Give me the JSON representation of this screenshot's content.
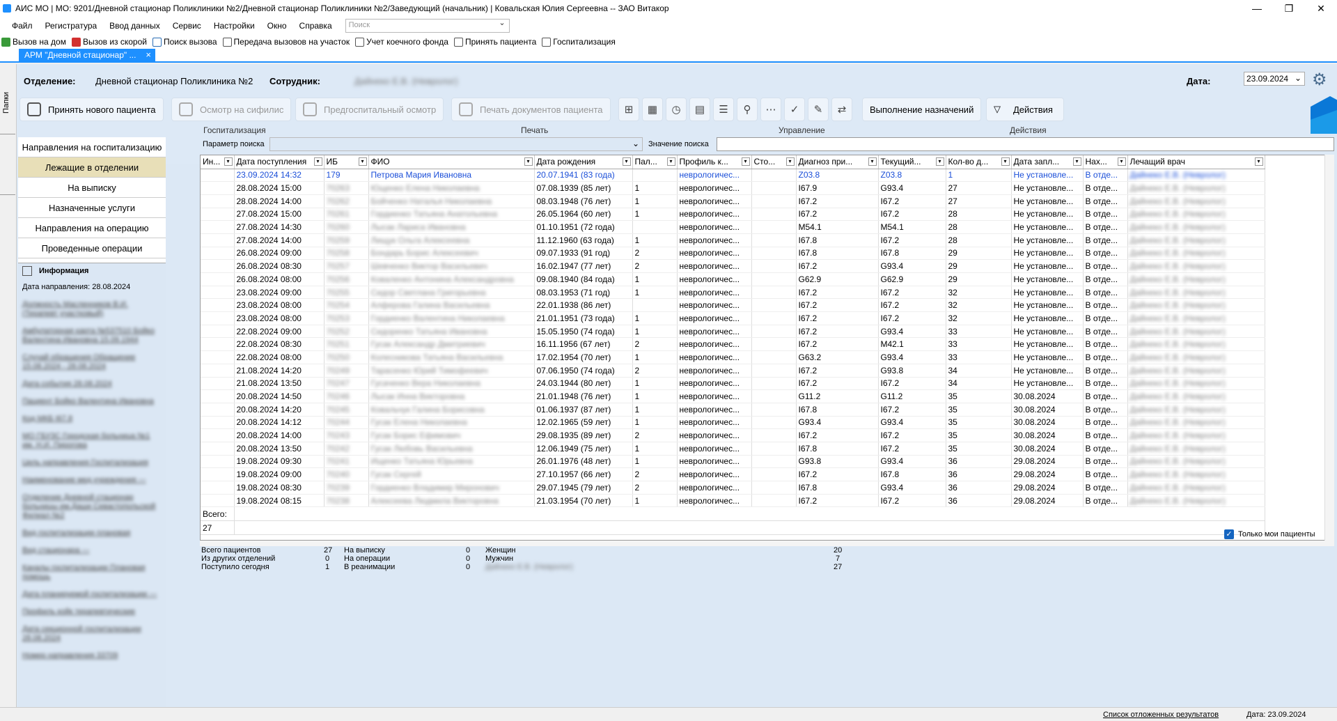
{
  "window": {
    "title": "АИС МО | МО: 9201/Дневной стационар Поликлиники №2/Дневной стационар Поликлиники №2/Заведующий (начальник) | Ковальская Юлия Сергеевна -- ЗАО Витакор"
  },
  "menu": [
    "Файл",
    "Регистратура",
    "Ввод данных",
    "Сервис",
    "Настройки",
    "Окно",
    "Справка"
  ],
  "menu_search_placeholder": "Поиск",
  "quick": [
    "Вызов на дом",
    "Вызов из скорой",
    "Поиск вызова",
    "Передача вызовов на участок",
    "Учет коечного фонда",
    "Принять пациента",
    "Госпитализация"
  ],
  "tab": {
    "label": "АРМ \"Дневной стационар\" ...",
    "close": "×"
  },
  "left_strip_label": "Папки",
  "header": {
    "dept_label": "Отделение:",
    "dept_value": "Дневной стационар Поликлиника №2",
    "emp_label": "Сотрудник:",
    "emp_value": "Дайнеко Е.В. (Невролог)",
    "date_label": "Дата:",
    "date_value": "23.09.2024"
  },
  "toolbar": {
    "new_patient": "Принять нового пациента",
    "syphilis": "Осмотр на сифилис",
    "prehosp": "Предгоспитальный осмотр",
    "print_docs": "Печать документов пациента",
    "appointments": "Выполнение назначений",
    "actions": "Действия"
  },
  "groups": {
    "hosp": "Госпитализация",
    "print": "Печать",
    "manage": "Управление",
    "actions": "Действия"
  },
  "nav": [
    "Направления на госпитализацию",
    "Лежащие в отделении",
    "На выписку",
    "Назначенные услуги",
    "Направления на операцию",
    "Проведенные операции"
  ],
  "info": {
    "title": "Информация",
    "date": "Дата направления: 28.08.2024",
    "lines": [
      "Должность Масленников В.И. (Терапевт участковый)",
      "Амбулаторная карта №537510 Бойко Валентина Ивановна 15.09.1944",
      "Случай обращения Обращение 15.08.2024 - 28.08.2024",
      "Дата события 28.08.2024",
      "Пациент Бойко Валентина Ивановна",
      "Код МКБ I67.8",
      "МО ГБУЗС Городская больница №1 им. Н.И. Пирогова",
      "Цель направления Госпитализация",
      "Наименование мед.учреждения ---",
      "Отделение Дневной стационар больницы им.Даши Севастопольской Филиал №2",
      "Вид госпитализации плановая",
      "Вид стационара ---",
      "Каналы госпитализации Плановая помощь",
      "Дата планируемой госпитализации ---",
      "Профиль койк терапевтические",
      "Дата секционной госпитализации 28.08.2024",
      "Номер направления 33709"
    ]
  },
  "search": {
    "param_label": "Параметр поиска",
    "value_label": "Значение поиска"
  },
  "columns": [
    "Ин...",
    "Дата поступления",
    "ИБ",
    "ФИО",
    "Дата рождения",
    "Пал...",
    "Профиль к...",
    "Сто...",
    "Диагноз при...",
    "Текущий...",
    "Кол-во д...",
    "Дата запл...",
    "Нах...",
    "Лечащий врач"
  ],
  "rows": [
    [
      "",
      "23.09.2024 14:32",
      "179",
      "Петрова Мария Ивановна",
      "20.07.1941 (83 года)",
      "",
      "неврологичес...",
      "",
      "Z03.8",
      "Z03.8",
      "1",
      "Не установле...",
      "В отде...",
      "Дайнеко Е.В. (Невролог)"
    ],
    [
      "",
      "28.08.2024 15:00",
      "70263",
      "Ющенко Елена Николаевна",
      "07.08.1939 (85 лет)",
      "1",
      "неврологичес...",
      "",
      "I67.9",
      "G93.4",
      "27",
      "Не установле...",
      "В отде...",
      "Дайнеко Е.В. (Невролог)"
    ],
    [
      "",
      "28.08.2024 14:00",
      "70262",
      "Бойченко Наталья Николаевна",
      "08.03.1948 (76 лет)",
      "1",
      "неврологичес...",
      "",
      "I67.2",
      "I67.2",
      "27",
      "Не установле...",
      "В отде...",
      "Дайнеко Е.В. (Невролог)"
    ],
    [
      "",
      "27.08.2024 15:00",
      "70261",
      "Гордиенко Татьяна Анатольевна",
      "26.05.1964 (60 лет)",
      "1",
      "неврологичес...",
      "",
      "I67.2",
      "I67.2",
      "28",
      "Не установле...",
      "В отде...",
      "Дайнеко Е.В. (Невролог)"
    ],
    [
      "",
      "27.08.2024 14:30",
      "70260",
      "Лысак Лариса Ивановна",
      "01.10.1951 (72 года)",
      "",
      "неврологичес...",
      "",
      "M54.1",
      "M54.1",
      "28",
      "Не установле...",
      "В отде...",
      "Дайнеко Е.В. (Невролог)"
    ],
    [
      "",
      "27.08.2024 14:00",
      "70259",
      "Лищук Ольга Алексеевна",
      "11.12.1960 (63 года)",
      "1",
      "неврологичес...",
      "",
      "I67.8",
      "I67.2",
      "28",
      "Не установле...",
      "В отде...",
      "Дайнеко Е.В. (Невролог)"
    ],
    [
      "",
      "26.08.2024 09:00",
      "70258",
      "Бондарь Борис Алексеевич",
      "09.07.1933 (91 год)",
      "2",
      "неврологичес...",
      "",
      "I67.8",
      "I67.8",
      "29",
      "Не установле...",
      "В отде...",
      "Дайнеко Е.В. (Невролог)"
    ],
    [
      "",
      "26.08.2024 08:30",
      "70257",
      "Шевченко Виктор Васильевич",
      "16.02.1947 (77 лет)",
      "2",
      "неврологичес...",
      "",
      "I67.2",
      "G93.4",
      "29",
      "Не установле...",
      "В отде...",
      "Дайнеко Е.В. (Невролог)"
    ],
    [
      "",
      "26.08.2024 08:00",
      "70256",
      "Коваленко Антонина Александровна",
      "09.08.1940 (84 года)",
      "1",
      "неврологичес...",
      "",
      "G62.9",
      "G62.9",
      "29",
      "Не установле...",
      "В отде...",
      "Дайнеко Е.В. (Невролог)"
    ],
    [
      "",
      "23.08.2024 09:00",
      "70255",
      "Сидор Светлана Григорьевна",
      "08.03.1953 (71 год)",
      "1",
      "неврологичес...",
      "",
      "I67.2",
      "I67.2",
      "32",
      "Не установле...",
      "В отде...",
      "Дайнеко Е.В. (Невролог)"
    ],
    [
      "",
      "23.08.2024 08:00",
      "70254",
      "Алферова Галина Васильевна",
      "22.01.1938 (86 лет)",
      "",
      "неврологичес...",
      "",
      "I67.2",
      "I67.2",
      "32",
      "Не установле...",
      "В отде...",
      "Дайнеко Е.В. (Невролог)"
    ],
    [
      "",
      "23.08.2024 08:00",
      "70253",
      "Гордиенко Валентина Николаевна",
      "21.01.1951 (73 года)",
      "1",
      "неврологичес...",
      "",
      "I67.2",
      "I67.2",
      "32",
      "Не установле...",
      "В отде...",
      "Дайнеко Е.В. (Невролог)"
    ],
    [
      "",
      "22.08.2024 09:00",
      "70252",
      "Сидоренко Татьяна Ивановна",
      "15.05.1950 (74 года)",
      "1",
      "неврологичес...",
      "",
      "I67.2",
      "G93.4",
      "33",
      "Не установле...",
      "В отде...",
      "Дайнеко Е.В. (Невролог)"
    ],
    [
      "",
      "22.08.2024 08:30",
      "70251",
      "Гусак Александр Дмитриевич",
      "16.11.1956 (67 лет)",
      "2",
      "неврологичес...",
      "",
      "I67.2",
      "M42.1",
      "33",
      "Не установле...",
      "В отде...",
      "Дайнеко Е.В. (Невролог)"
    ],
    [
      "",
      "22.08.2024 08:00",
      "70250",
      "Колесникова Татьяна Васильевна",
      "17.02.1954 (70 лет)",
      "1",
      "неврологичес...",
      "",
      "G63.2",
      "G93.4",
      "33",
      "Не установле...",
      "В отде...",
      "Дайнеко Е.В. (Невролог)"
    ],
    [
      "",
      "21.08.2024 14:20",
      "70249",
      "Тарасенко Юрий Тимофеевич",
      "07.06.1950 (74 года)",
      "2",
      "неврологичес...",
      "",
      "I67.2",
      "G93.8",
      "34",
      "Не установле...",
      "В отде...",
      "Дайнеко Е.В. (Невролог)"
    ],
    [
      "",
      "21.08.2024 13:50",
      "70247",
      "Гусаченко Вера Николаевна",
      "24.03.1944 (80 лет)",
      "1",
      "неврологичес...",
      "",
      "I67.2",
      "I67.2",
      "34",
      "Не установле...",
      "В отде...",
      "Дайнеко Е.В. (Невролог)"
    ],
    [
      "",
      "20.08.2024 14:50",
      "70246",
      "Лысак Инна Викторовна",
      "21.01.1948 (76 лет)",
      "1",
      "неврологичес...",
      "",
      "G11.2",
      "G11.2",
      "35",
      "30.08.2024",
      "В отде...",
      "Дайнеко Е.В. (Невролог)"
    ],
    [
      "",
      "20.08.2024 14:20",
      "70245",
      "Ковальчук Галина Борисовна",
      "01.06.1937 (87 лет)",
      "1",
      "неврологичес...",
      "",
      "I67.8",
      "I67.2",
      "35",
      "30.08.2024",
      "В отде...",
      "Дайнеко Е.В. (Невролог)"
    ],
    [
      "",
      "20.08.2024 14:12",
      "70244",
      "Гусак Елена Николаевна",
      "12.02.1965 (59 лет)",
      "1",
      "неврологичес...",
      "",
      "G93.4",
      "G93.4",
      "35",
      "30.08.2024",
      "В отде...",
      "Дайнеко Е.В. (Невролог)"
    ],
    [
      "",
      "20.08.2024 14:00",
      "70243",
      "Гусак Борис Ефимович",
      "29.08.1935 (89 лет)",
      "2",
      "неврологичес...",
      "",
      "I67.2",
      "I67.2",
      "35",
      "30.08.2024",
      "В отде...",
      "Дайнеко Е.В. (Невролог)"
    ],
    [
      "",
      "20.08.2024 13:50",
      "70242",
      "Гусак Любовь Васильевна",
      "12.06.1949 (75 лет)",
      "1",
      "неврологичес...",
      "",
      "I67.8",
      "I67.2",
      "35",
      "30.08.2024",
      "В отде...",
      "Дайнеко Е.В. (Невролог)"
    ],
    [
      "",
      "19.08.2024 09:30",
      "70241",
      "Ищенко Татьяна Юрьевна",
      "26.01.1976 (48 лет)",
      "1",
      "неврологичес...",
      "",
      "G93.8",
      "G93.4",
      "36",
      "29.08.2024",
      "В отде...",
      "Дайнеко Е.В. (Невролог)"
    ],
    [
      "",
      "19.08.2024 09:00",
      "70240",
      "Гусак Сергей",
      "27.10.1957 (66 лет)",
      "2",
      "неврологичес...",
      "",
      "I67.2",
      "I67.8",
      "36",
      "29.08.2024",
      "В отде...",
      "Дайнеко Е.В. (Невролог)"
    ],
    [
      "",
      "19.08.2024 08:30",
      "70239",
      "Гордиенко Владимир Миронович",
      "29.07.1945 (79 лет)",
      "2",
      "неврологичес...",
      "",
      "I67.8",
      "G93.4",
      "36",
      "29.08.2024",
      "В отде...",
      "Дайнеко Е.В. (Невролог)"
    ],
    [
      "",
      "19.08.2024 08:15",
      "70238",
      "Алексеева Людмила Викторовна",
      "21.03.1954 (70 лет)",
      "1",
      "неврологичес...",
      "",
      "I67.2",
      "I67.2",
      "36",
      "29.08.2024",
      "В отде...",
      "Дайнеко Е.В. (Невролог)"
    ]
  ],
  "total": {
    "label": "Всего:",
    "count": "27"
  },
  "only_mine": "Только мои пациенты",
  "stats": {
    "total_patients": "Всего пациентов",
    "total_patients_v": "27",
    "other_depts": "Из других отделений",
    "other_depts_v": "0",
    "today": "Поступило сегодня",
    "today_v": "1",
    "discharge": "На выписку",
    "discharge_v": "0",
    "operation": "На операции",
    "operation_v": "0",
    "icu": "В реанимации",
    "icu_v": "0",
    "women": "Женщин",
    "women_v": "20",
    "men": "Мужчин",
    "men_v": "7",
    "doctor": "Дайнеко Е.В. (Невролог)",
    "doctor_v": "27"
  },
  "status": {
    "deferred": "Список отложенных результатов",
    "date": "Дата: 23.09.2024"
  }
}
